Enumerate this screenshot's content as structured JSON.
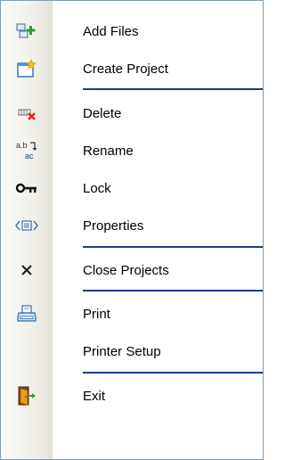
{
  "menu": {
    "items": [
      {
        "label": "Add Files",
        "icon": "add-files-icon"
      },
      {
        "label": "Create Project",
        "icon": "create-project-icon"
      },
      {
        "label": "Delete",
        "icon": "delete-icon"
      },
      {
        "label": "Rename",
        "icon": "rename-icon"
      },
      {
        "label": "Lock",
        "icon": "lock-key-icon"
      },
      {
        "label": "Properties",
        "icon": "properties-icon"
      },
      {
        "label": "Close Projects",
        "icon": "close-icon"
      },
      {
        "label": "Print",
        "icon": "printer-icon"
      },
      {
        "label": "Printer Setup",
        "icon": ""
      },
      {
        "label": "Exit",
        "icon": "exit-door-icon"
      }
    ]
  },
  "colors": {
    "separator": "#1f3a8c",
    "border": "#7f9db9",
    "gutter": "#f1f0ea",
    "delete_red": "#e02020",
    "add_green": "#2e9a2e"
  }
}
